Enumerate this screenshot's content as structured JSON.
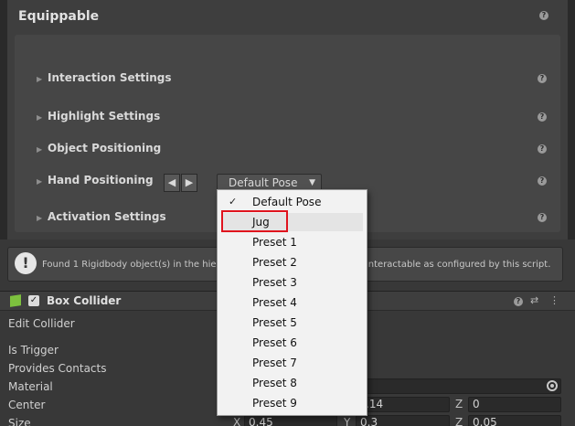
{
  "equippable": {
    "title": "Equippable",
    "rows": [
      {
        "label": "Interaction Settings"
      },
      {
        "label": "Highlight Settings"
      },
      {
        "label": "Object Positioning"
      },
      {
        "label": "Hand Positioning"
      },
      {
        "label": "Activation Settings"
      }
    ],
    "pose_dropdown_value": "Default Pose"
  },
  "warning": {
    "text_left": "Found 1 Rigidbody object(s) in the hiera",
    "text_right": "interactable as configured by this script."
  },
  "box_collider": {
    "title": "Box Collider",
    "edit_collider": "Edit Collider",
    "properties": [
      "Is Trigger",
      "Provides Contacts",
      "Material",
      "Center",
      "Size"
    ],
    "center": {
      "y_partial": ".14",
      "z_label": "Z",
      "z": "0"
    },
    "size": {
      "x_label": "X",
      "x": "0.45",
      "y_label": "Y",
      "y": "0.3",
      "z_label": "Z",
      "z": "0.05"
    }
  },
  "popup_menu": {
    "items": [
      "Default Pose",
      "Jug",
      "Preset 1",
      "Preset 2",
      "Preset 3",
      "Preset 4",
      "Preset 5",
      "Preset 6",
      "Preset 7",
      "Preset 8",
      "Preset 9"
    ],
    "checked": "Default Pose",
    "hovered": "Jug"
  },
  "colors": {
    "highlight_outline": "#e0141e",
    "collider_icon": "#7dc13e"
  },
  "icons": {
    "help": "help-icon",
    "foldout": "triangle-right-icon",
    "prev": "arrow-left-icon",
    "next": "arrow-right-icon",
    "warning": "exclamation-icon",
    "cube": "cube-icon",
    "presets": "sliders-icon",
    "more": "kebab-menu-icon",
    "object_picker": "target-icon"
  }
}
